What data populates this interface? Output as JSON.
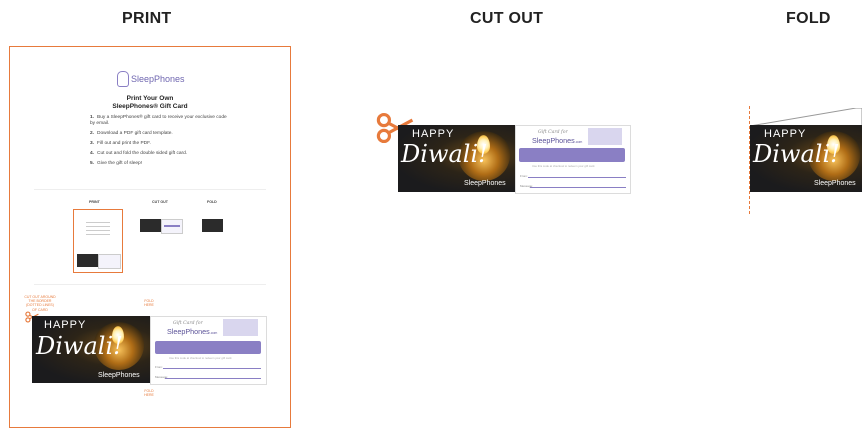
{
  "headings": {
    "print": "PRINT",
    "cut_out": "CUT OUT",
    "fold": "FOLD"
  },
  "print_page": {
    "logo_text": "SleepPhones",
    "title_line1": "Print Your Own",
    "title_line2": "SleepPhones® Gift Card",
    "steps": [
      {
        "num": "1.",
        "text": "Buy a SleepPhones® gift card to receive your exclusive code by email."
      },
      {
        "num": "2.",
        "text": "Download a PDF gift card template."
      },
      {
        "num": "3.",
        "text": "Fill out and print the PDF."
      },
      {
        "num": "4.",
        "text": "Cut out and fold the double sided gift card."
      },
      {
        "num": "5.",
        "text": "Give the gift of sleep!"
      }
    ],
    "mini_labels": {
      "print": "PRINT",
      "cut_out": "CUT OUT",
      "fold": "FOLD"
    },
    "cut_guide_text": "CUT OUT AROUND THE BORDER (DOTTED LINES) OF CARD",
    "fold_text_top": "FOLD HERE",
    "fold_text_bottom": "FOLD HERE"
  },
  "card": {
    "happy": "HAPPY",
    "diwali": "Diwali!",
    "brand": "SleepPhones",
    "gift_card_for": "Gift Card for",
    "logo": "SleepPhones",
    "logo_suffix": ".com",
    "fine_print": "Use this code at checkout to redeem your gift card.",
    "from_label": "From:",
    "message_label": "Message:"
  },
  "colors": {
    "accent": "#e77a3c",
    "brand_purple": "#8a7fc4"
  },
  "icons": {
    "scissors": "scissors-icon"
  }
}
